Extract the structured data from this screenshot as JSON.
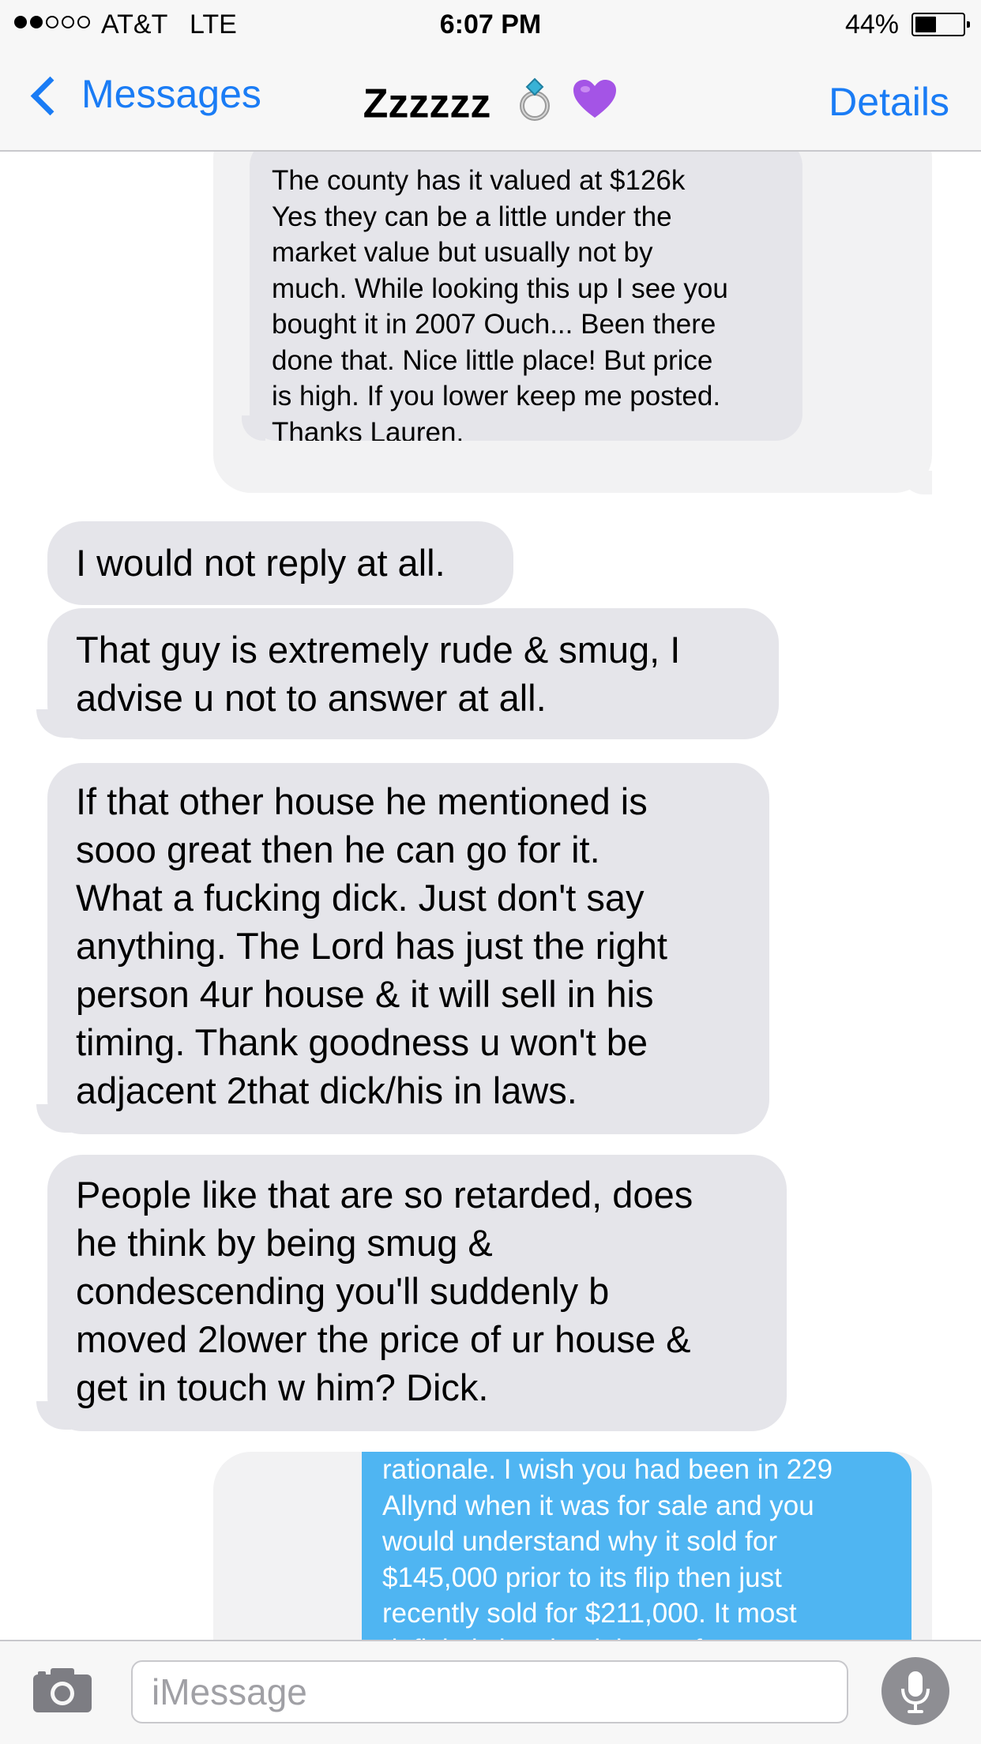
{
  "status_bar": {
    "carrier": "AT&T",
    "network": "LTE",
    "time": "6:07 PM",
    "battery_percent": "44%",
    "battery_level": 0.44,
    "signal_bars_filled": 2,
    "signal_bars_total": 5
  },
  "nav": {
    "back_label": "Messages",
    "title": "Zzzzzz",
    "details_label": "Details",
    "title_icons": [
      "ring-icon",
      "purple-heart-icon"
    ]
  },
  "preview_incoming": {
    "text": "The county has it valued at $126k\nYes they can be a little under the\nmarket value but usually not by\nmuch. While looking this up I see you\nbought it in 2007 Ouch... Been there\ndone that. Nice little place! But price\nis high. If you lower keep me posted.\nThanks Lauren."
  },
  "messages": [
    {
      "text": "I would not reply at all."
    },
    {
      "text": "That guy is extremely rude & smug, I\nadvise u not to answer at all."
    },
    {
      "text": "If that other house he mentioned is\nsooo great then he can go for it.\nWhat a fucking dick. Just don't say\nanything. The Lord has just the right\nperson 4ur house & it will sell in his\ntiming. Thank goodness u won't be\nadjacent 2that dick/his in laws."
    },
    {
      "text": "People like that are so retarded, does\nhe think by being smug &\ncondescending you'll suddenly b\nmoved 2lower the price of ur house &\nget in touch w him? Dick."
    }
  ],
  "preview_outgoing": {
    "text": "rationale. I wish you had been in 229\nAllynd when it was for sale and you\nwould understand why it sold for\n$145,000 prior to its flip then just\nrecently sold for $211,000. It most\ndefinitely involved the perfect"
  },
  "input": {
    "placeholder": "iMessage",
    "value": ""
  },
  "colors": {
    "accent": "#1a7cf5",
    "incoming_bubble": "#e5e5ea",
    "outgoing_bubble": "#4fb5f2",
    "bar_background": "#f7f7f7"
  }
}
